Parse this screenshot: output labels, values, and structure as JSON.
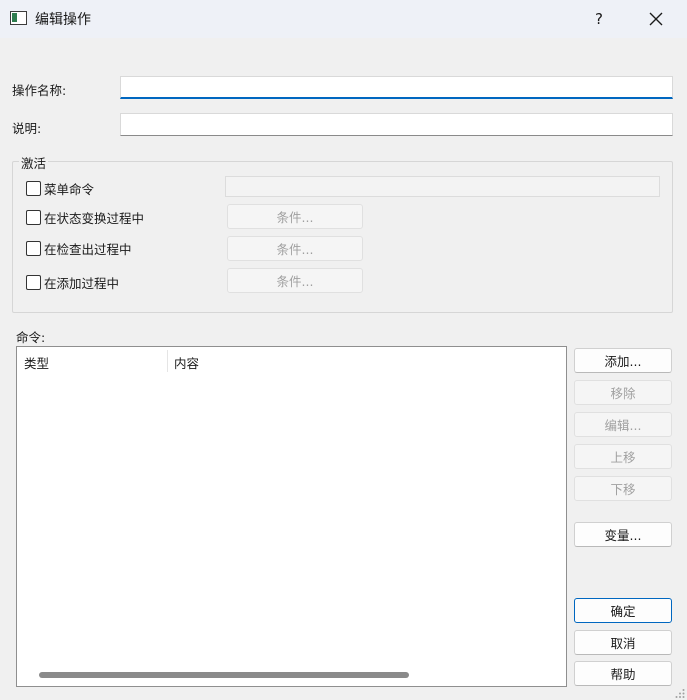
{
  "window": {
    "title": "编辑操作",
    "help_label": "?",
    "icons": [
      "app-icon",
      "help-icon",
      "close-icon"
    ]
  },
  "form": {
    "name_label": "操作名称:",
    "name_value": "",
    "desc_label": "说明:",
    "desc_value": ""
  },
  "activation": {
    "title": "激活",
    "items": [
      {
        "label": "菜单命令",
        "checked": false
      },
      {
        "label": "在状态变换过程中",
        "checked": false,
        "button": "条件..."
      },
      {
        "label": "在检查出过程中",
        "checked": false,
        "button": "条件..."
      },
      {
        "label": "在添加过程中",
        "checked": false,
        "button": "条件..."
      }
    ]
  },
  "commands": {
    "label": "命令:",
    "columns": [
      "类型",
      "内容"
    ],
    "rows": []
  },
  "buttons": {
    "add": "添加...",
    "remove": "移除",
    "edit": "编辑...",
    "move_up": "上移",
    "move_down": "下移",
    "variables": "变量...",
    "ok": "确定",
    "cancel": "取消",
    "help": "帮助"
  },
  "colors": {
    "accent": "#0067c0",
    "titlebar": "#eef1f7",
    "background": "#f0f0f0"
  }
}
